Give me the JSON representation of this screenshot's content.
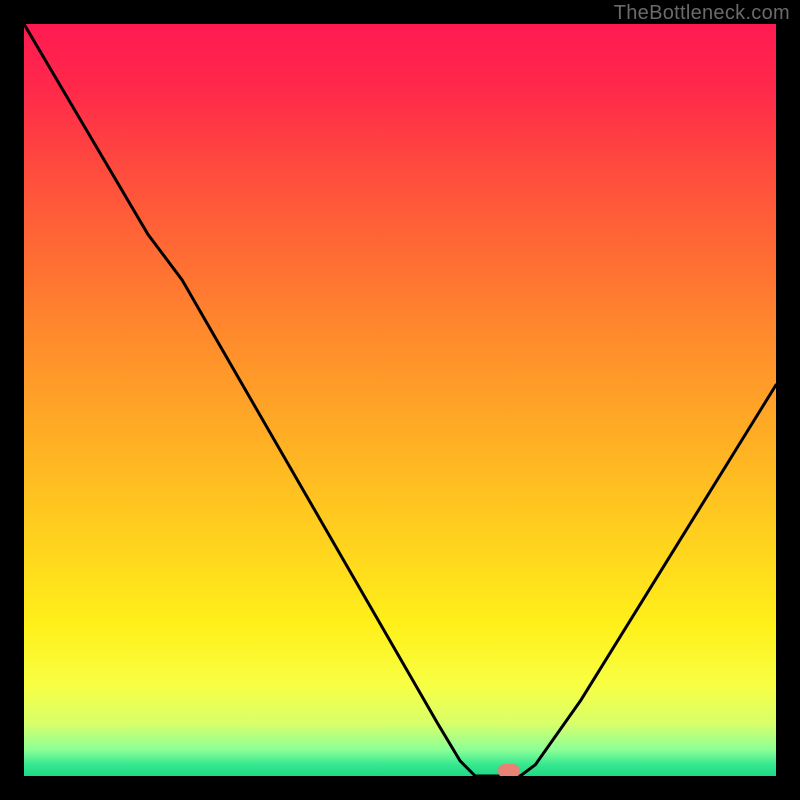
{
  "watermark": {
    "text": "TheBottleneck.com"
  },
  "colors": {
    "bg": "#000000",
    "watermark": "#6a6a6a",
    "curve": "#000000",
    "marker": "#e98174",
    "gradient_stops": [
      {
        "pct": 0.0,
        "color": "#ff1a52"
      },
      {
        "pct": 0.09,
        "color": "#ff2a4a"
      },
      {
        "pct": 0.19,
        "color": "#ff4a3e"
      },
      {
        "pct": 0.3,
        "color": "#ff6a34"
      },
      {
        "pct": 0.42,
        "color": "#ff8c2c"
      },
      {
        "pct": 0.55,
        "color": "#ffae24"
      },
      {
        "pct": 0.68,
        "color": "#ffd01e"
      },
      {
        "pct": 0.8,
        "color": "#fff01a"
      },
      {
        "pct": 0.88,
        "color": "#f8ff44"
      },
      {
        "pct": 0.93,
        "color": "#d8ff6a"
      },
      {
        "pct": 0.965,
        "color": "#8cff96"
      },
      {
        "pct": 0.985,
        "color": "#35e890"
      },
      {
        "pct": 1.0,
        "color": "#1fd884"
      }
    ]
  },
  "chart_data": {
    "type": "line",
    "title": "",
    "xlabel": "",
    "ylabel": "",
    "xlim": [
      0,
      100
    ],
    "ylim": [
      0,
      100
    ],
    "curve": [
      {
        "x": 0.0,
        "y": 100.0
      },
      {
        "x": 16.5,
        "y": 72.0
      },
      {
        "x": 21.0,
        "y": 66.0
      },
      {
        "x": 55.0,
        "y": 7.0
      },
      {
        "x": 58.0,
        "y": 2.0
      },
      {
        "x": 60.0,
        "y": 0.0
      },
      {
        "x": 66.0,
        "y": 0.0
      },
      {
        "x": 68.0,
        "y": 1.5
      },
      {
        "x": 74.0,
        "y": 10.0
      },
      {
        "x": 100.0,
        "y": 52.0
      }
    ],
    "marker": {
      "x": 64.5,
      "y": 0.7
    },
    "grid": false,
    "legend": null
  }
}
